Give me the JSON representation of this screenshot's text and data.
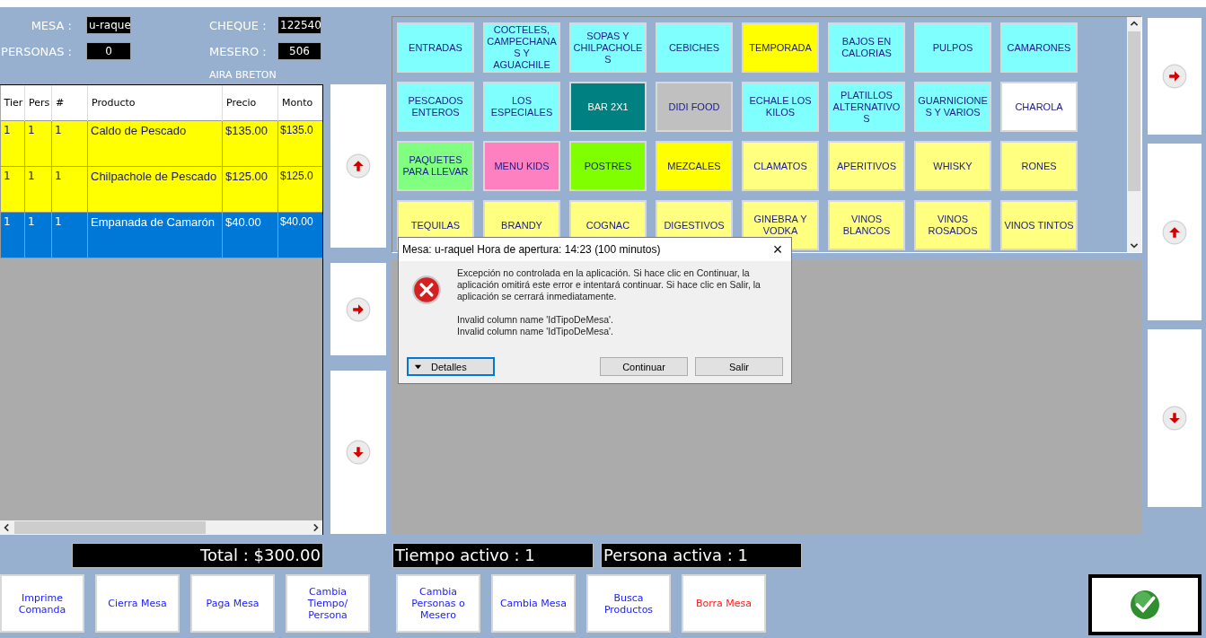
{
  "header": {
    "mesa_label": "MESA :",
    "mesa": "u-raque",
    "personas_label": "PERSONAS :",
    "personas": "0",
    "cheque_label": "CHEQUE :",
    "cheque": "122540",
    "mesero_label": "MESERO :",
    "mesero": "506",
    "mesero_name": "AIRA BRETON"
  },
  "order_table": {
    "columns": [
      "Tier",
      "Pers",
      "#",
      "Producto",
      "Precio",
      "Monto"
    ],
    "rows": [
      {
        "cells": [
          "1",
          "1",
          "1",
          "Caldo de Pescado",
          "$135.00",
          "$135.0"
        ],
        "selected": false
      },
      {
        "cells": [
          "1",
          "1",
          "1",
          "Chilpachole de Pescado",
          "$125.00",
          "$125.0"
        ],
        "selected": false
      },
      {
        "cells": [
          "1",
          "1",
          "1",
          "Empanada de Camarón",
          "$40.00",
          "$40.00"
        ],
        "selected": true
      }
    ]
  },
  "categories": [
    {
      "label": "ENTRADAS",
      "color": "#80ffff"
    },
    {
      "label": "COCTELES, CAMPECHANAS Y AGUACHILE",
      "color": "#80ffff"
    },
    {
      "label": "SOPAS Y CHILPACHOLES",
      "color": "#80ffff"
    },
    {
      "label": "CEBICHES",
      "color": "#80ffff"
    },
    {
      "label": "TEMPORADA",
      "color": "#ffff00"
    },
    {
      "label": "BAJOS EN CALORIAS",
      "color": "#80ffff"
    },
    {
      "label": "PULPOS",
      "color": "#80ffff"
    },
    {
      "label": "CAMARONES",
      "color": "#80ffff"
    },
    {
      "label": "PESCADOS ENTEROS",
      "color": "#80ffff"
    },
    {
      "label": "LOS ESPECIALES",
      "color": "#80ffff"
    },
    {
      "label": "BAR 2X1",
      "color": "#008080"
    },
    {
      "label": "DIDI FOOD",
      "color": "#c0c0c0"
    },
    {
      "label": "ECHALE LOS KILOS",
      "color": "#80ffff"
    },
    {
      "label": "PLATILLOS ALTERNATIVOS",
      "color": "#80ffff"
    },
    {
      "label": "GUARNICIONES Y VARIOS",
      "color": "#80ffff"
    },
    {
      "label": "CHAROLA",
      "color": "#ffffff"
    },
    {
      "label": "PAQUETES PARA LLEVAR",
      "color": "#80ff80"
    },
    {
      "label": "MENU KIDS",
      "color": "#ff80c0"
    },
    {
      "label": "POSTRES",
      "color": "#80ff00"
    },
    {
      "label": "MEZCALES",
      "color": "#ffff00"
    },
    {
      "label": "CLAMATOS",
      "color": "#ffff80"
    },
    {
      "label": "APERITIVOS",
      "color": "#ffff80"
    },
    {
      "label": "WHISKY",
      "color": "#ffff80"
    },
    {
      "label": "RONES",
      "color": "#ffff80"
    },
    {
      "label": "TEQUILAS",
      "color": "#ffff80"
    },
    {
      "label": "BRANDY",
      "color": "#ffff80"
    },
    {
      "label": "COGNAC",
      "color": "#ffff80"
    },
    {
      "label": "DIGESTIVOS",
      "color": "#ffff80"
    },
    {
      "label": "GINEBRA Y VODKA",
      "color": "#ffff80"
    },
    {
      "label": "VINOS BLANCOS",
      "color": "#ffff80"
    },
    {
      "label": "VINOS ROSADOS",
      "color": "#ffff80"
    },
    {
      "label": "VINOS TINTOS",
      "color": "#ffff80"
    }
  ],
  "totals": {
    "total": "Total : $300.00",
    "tiempo": "Tiempo activo : 1",
    "persona": "Persona activa : 1"
  },
  "actions": [
    {
      "label": "Imprime Comanda",
      "kind": "normal"
    },
    {
      "label": "Cierra Mesa",
      "kind": "normal"
    },
    {
      "label": "Paga Mesa",
      "kind": "normal"
    },
    {
      "label": "Cambia Tiempo/ Persona",
      "kind": "normal"
    },
    {
      "label": "Cambia Personas o Mesero",
      "kind": "normal"
    },
    {
      "label": "Cambia Mesa",
      "kind": "normal"
    },
    {
      "label": "Busca Productos",
      "kind": "normal"
    },
    {
      "label": "Borra Mesa",
      "kind": "danger"
    }
  ],
  "dialog": {
    "title": "Mesa: u-raquel Hora de apertura: 14:23 (100 minutos)",
    "close": "×",
    "message": "Excepción no controlada en la aplicación. Si hace clic en Continuar, la aplicación omitirá este error e intentará continuar. Si hace clic en Salir, la aplicación se cerrará inmediatamente.",
    "details_text": [
      "Invalid column name 'IdTipoDeMesa'.",
      "Invalid column name 'IdTipoDeMesa'."
    ],
    "buttons": [
      "Continuar",
      "Salir"
    ],
    "details_button": "Detalles"
  }
}
